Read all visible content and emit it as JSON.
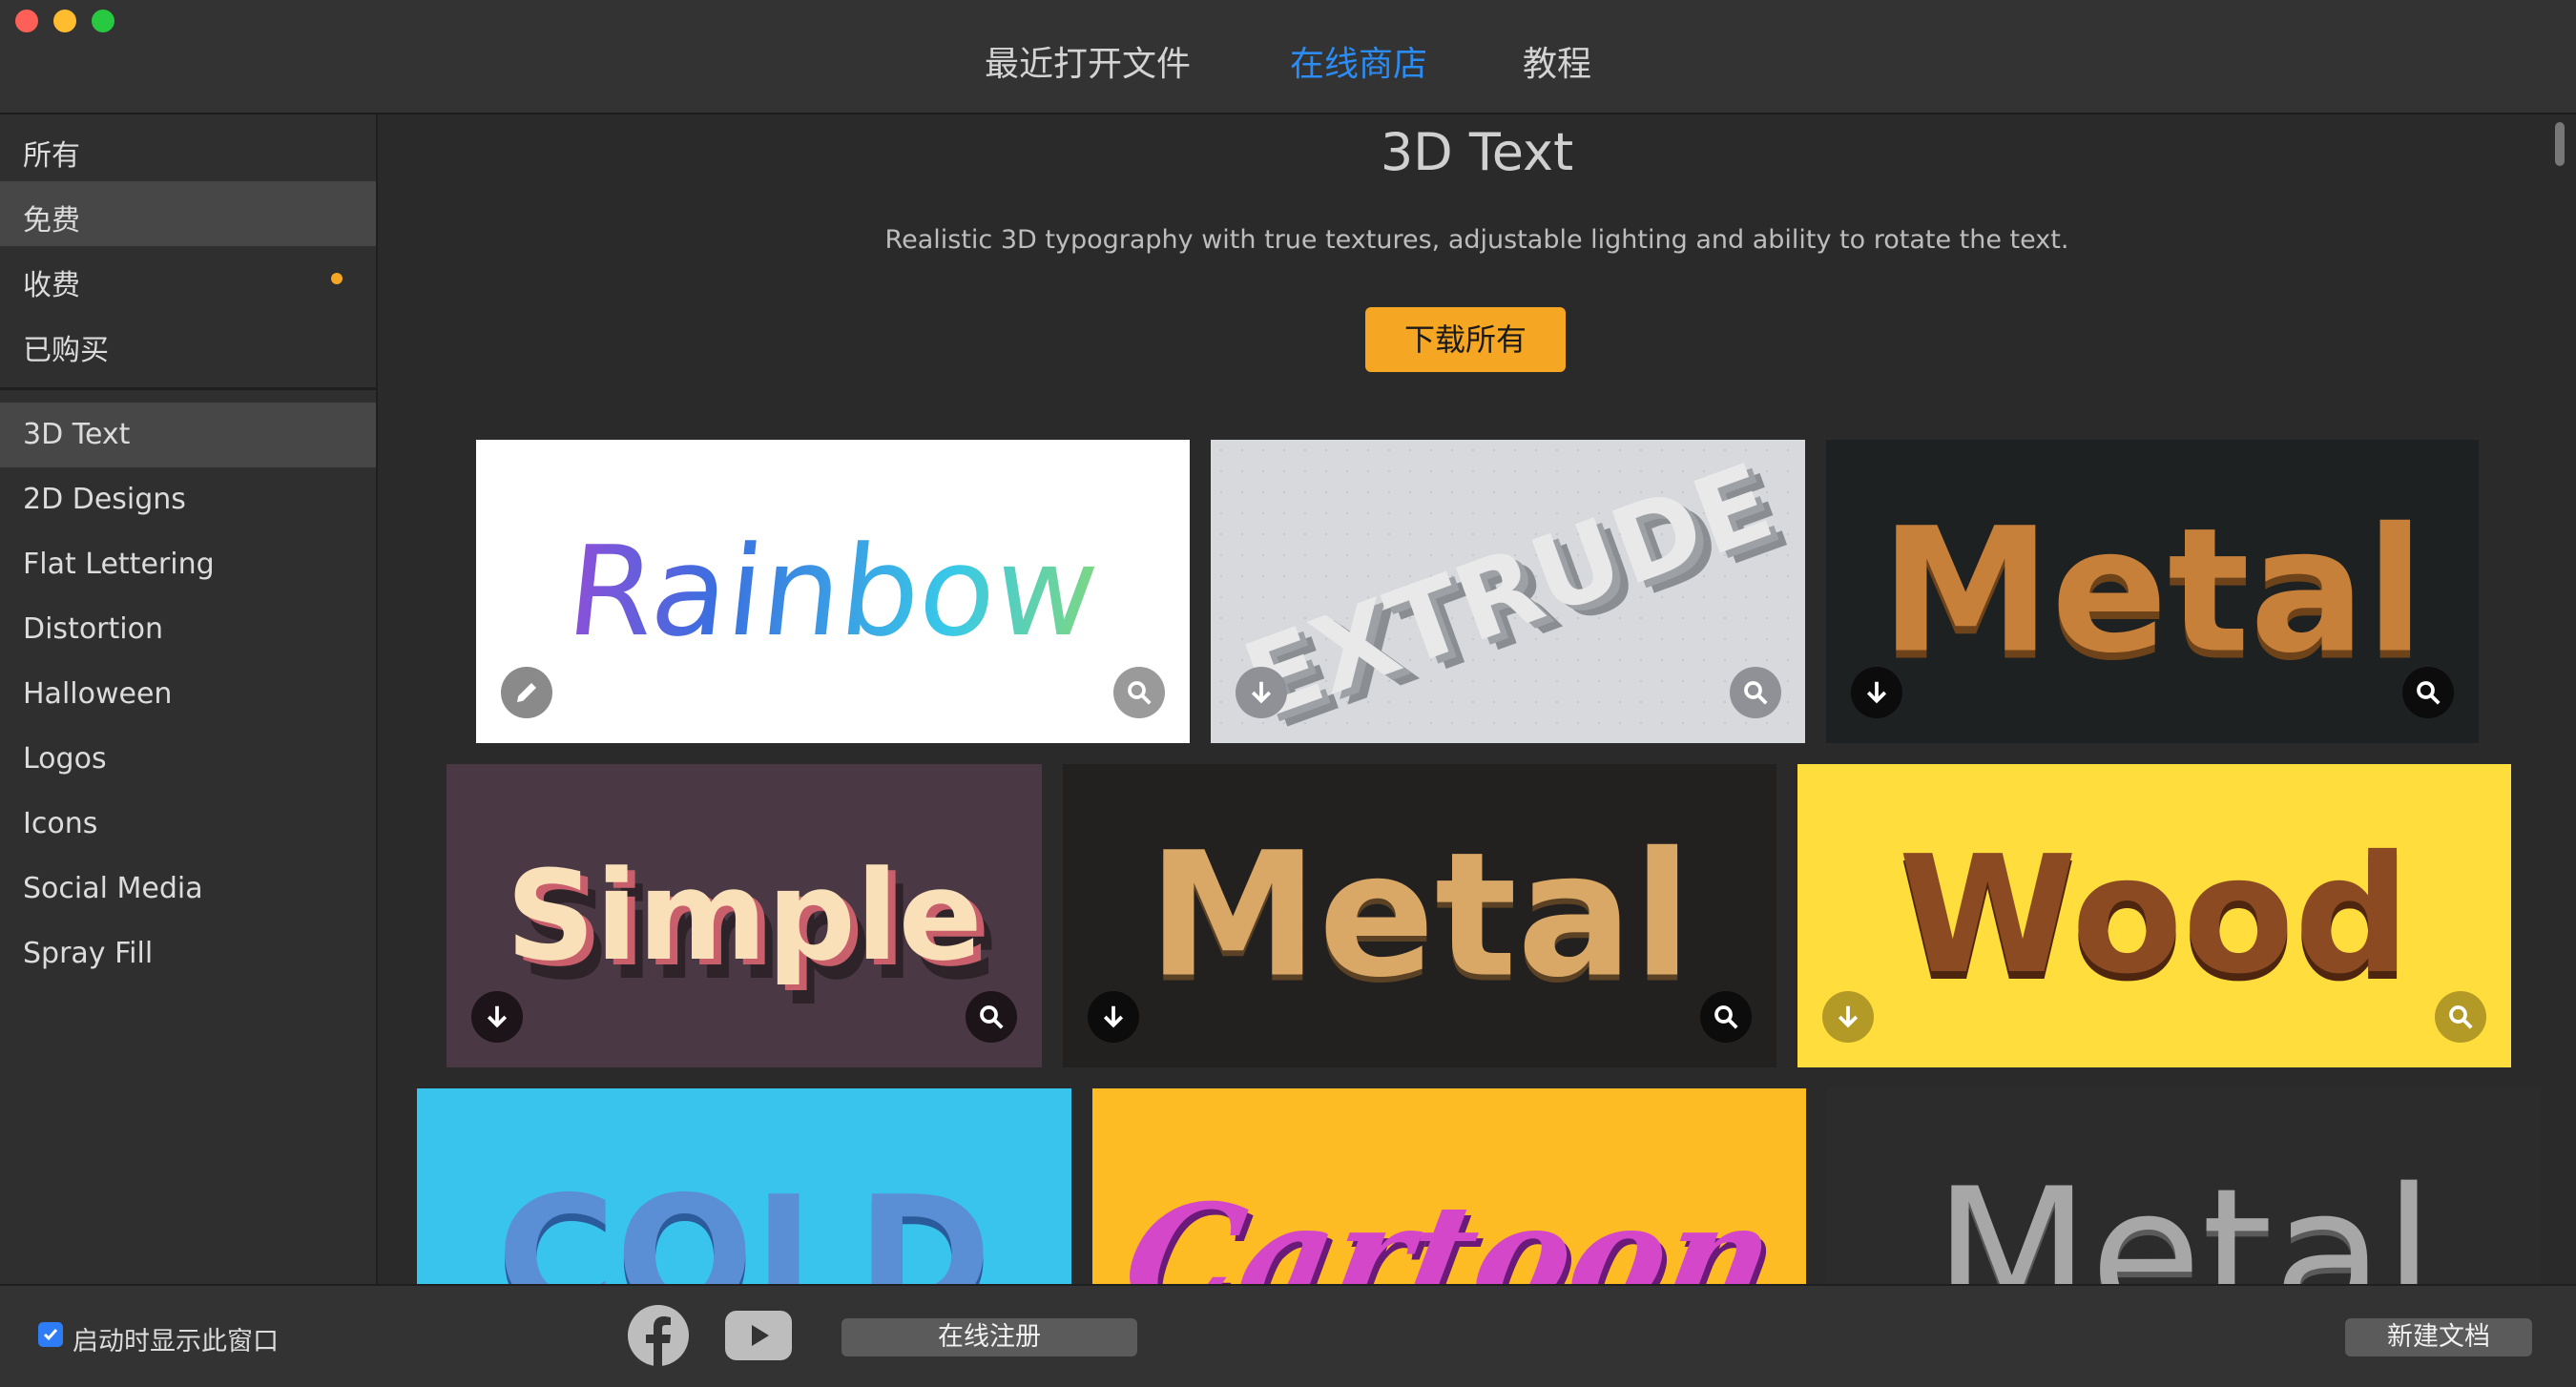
{
  "header": {
    "tabs": [
      {
        "label": "最近打开文件",
        "active": false
      },
      {
        "label": "在线商店",
        "active": true
      },
      {
        "label": "教程",
        "active": false
      }
    ]
  },
  "sidebar": {
    "filters": [
      {
        "label": "所有"
      },
      {
        "label": "免费",
        "selected": true
      },
      {
        "label": "收费",
        "dot": true
      },
      {
        "label": "已购买"
      }
    ],
    "categories": [
      {
        "label": "3D Text",
        "selected": true
      },
      {
        "label": "2D Designs"
      },
      {
        "label": "Flat Lettering"
      },
      {
        "label": "Distortion"
      },
      {
        "label": "Halloween"
      },
      {
        "label": "Logos"
      },
      {
        "label": "Icons"
      },
      {
        "label": "Social Media"
      },
      {
        "label": "Spray Fill"
      }
    ]
  },
  "main": {
    "title": "3D Text",
    "description": "Realistic 3D typography with true textures, adjustable lighting and ability to rotate the text.",
    "download_all": "下载所有",
    "cards": [
      {
        "text": "Rainbow",
        "action": "edit"
      },
      {
        "text": "EXTRUDE",
        "action": "download"
      },
      {
        "text": "Metal",
        "action": "download"
      },
      {
        "text": "Simple",
        "action": "download"
      },
      {
        "text": "Metal",
        "action": "download"
      },
      {
        "text": "Wood",
        "action": "download"
      },
      {
        "text": "COLD"
      },
      {
        "text": "Cartoon"
      },
      {
        "text": "Metal"
      }
    ]
  },
  "footer": {
    "show_on_launch_label": "启动时显示此窗口",
    "show_on_launch_checked": true,
    "register_label": "在线注册",
    "new_document_label": "新建文档"
  },
  "colors": {
    "accent_blue": "#2b8cf5",
    "accent_orange": "#f5a623"
  }
}
